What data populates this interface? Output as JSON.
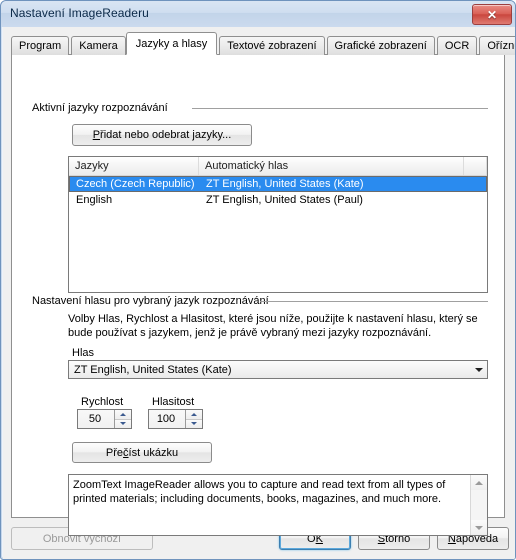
{
  "window": {
    "title": "Nastavení ImageReaderu",
    "close_glyph": "✕",
    "close_label": "Zavřít"
  },
  "tabs": [
    {
      "label": "Program",
      "selected": false
    },
    {
      "label": "Kamera",
      "selected": false
    },
    {
      "label": "Jazyky a hlasy",
      "selected": true
    },
    {
      "label": "Textové zobrazení",
      "selected": false
    },
    {
      "label": "Grafické zobrazení",
      "selected": false
    },
    {
      "label": "OCR",
      "selected": false
    },
    {
      "label": "Oříznutí",
      "selected": false
    }
  ],
  "groups": {
    "languages": {
      "label": "Aktivní jazyky rozpoznávání",
      "add_remove_button": "Přidat nebo odebrat jazyky...",
      "add_remove_accel": "P",
      "list": {
        "columns": [
          "Jazyky",
          "Automatický hlas"
        ],
        "rows": [
          {
            "language": "Czech (Czech Republic)",
            "voice": "ZT English, United States  (Kate)",
            "selected": true
          },
          {
            "language": "English",
            "voice": "ZT English, United States  (Paul)",
            "selected": false
          }
        ]
      }
    },
    "voice": {
      "label": "Nastavení hlasu pro vybraný jazyk rozpoznávání",
      "description_line1": "Volby Hlas, Rychlost a Hlasitost, které jsou níže, použijte k nastavení hlasu, který se",
      "description_line2": "bude používat s jazykem, jenž je právě vybraný mezi jazyky rozpoznávání.",
      "voice_label": "Hlas",
      "voice_value": "ZT English, United States  (Kate)",
      "rate_label": "Rychlost",
      "rate_value": "50",
      "volume_label": "Hlasitost",
      "volume_value": "100",
      "sample_button": "Přečíst ukázku",
      "sample_button_accel": "č",
      "sample_text_line1": "ZoomText ImageReader allows you to capture and read text from all types of",
      "sample_text_line2": "printed materials; including documents, books, magazines, and much more."
    }
  },
  "footer": {
    "restore_defaults": "Obnovit výchozí",
    "restore_defaults_disabled": true,
    "ok": "OK",
    "ok_accel": "K",
    "cancel": "Storno",
    "cancel_accel": "S",
    "help": "Nápověda",
    "help_accel": "N"
  },
  "colors": {
    "selection_blue": "#2a8bef",
    "titlebar_text": "#0b2948",
    "close_red": "#c9453c",
    "focus_blue": "#3c7fb1",
    "disabled_text": "#9a9a9a"
  }
}
